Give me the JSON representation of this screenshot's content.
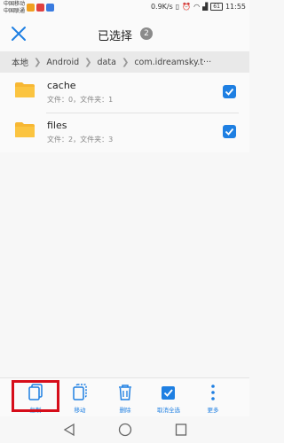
{
  "status_bar": {
    "carrier_1": "中国移动",
    "carrier_2": "中国联通",
    "speed": "0.9K/s",
    "battery": "61",
    "time": "11:55"
  },
  "header": {
    "title": "已选择",
    "selected_count": "2"
  },
  "breadcrumb": [
    "本地",
    "Android",
    "data",
    "com.idreamsky.t···"
  ],
  "files": [
    {
      "name": "cache",
      "meta": "文件：0，文件夹：1",
      "checked": true
    },
    {
      "name": "files",
      "meta": "文件：2，文件夹：3",
      "checked": true
    }
  ],
  "actions": [
    {
      "label": "复制",
      "icon": "copy-icon"
    },
    {
      "label": "移动",
      "icon": "move-icon"
    },
    {
      "label": "删除",
      "icon": "trash-icon"
    },
    {
      "label": "取消全选",
      "icon": "deselect-all-icon"
    },
    {
      "label": "更多",
      "icon": "more-icon"
    }
  ],
  "colors": {
    "accent": "#1e7fe2",
    "folder": "#f7b733",
    "highlight": "#d60d1a"
  }
}
